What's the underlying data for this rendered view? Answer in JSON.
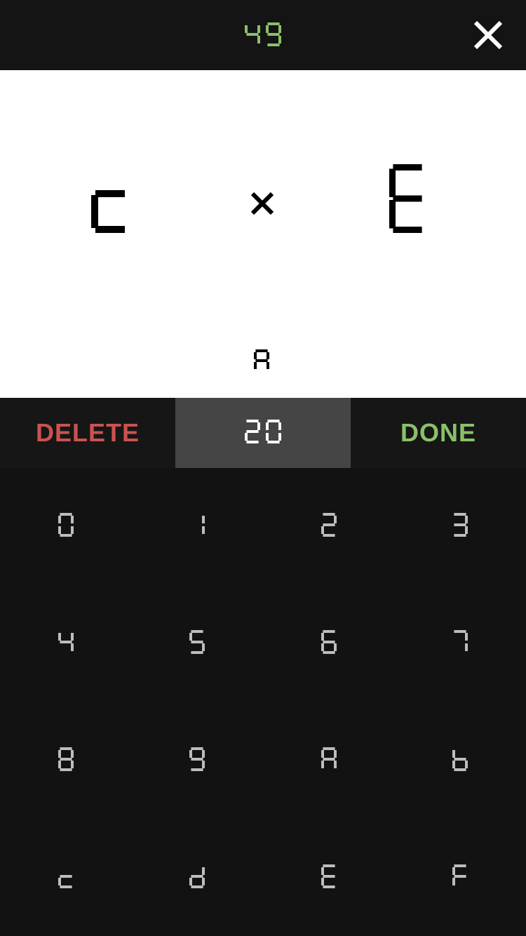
{
  "header": {
    "timer": "49",
    "close_icon": "close-icon"
  },
  "problem": {
    "operand_left": "c",
    "operator": "×",
    "operand_right": "E",
    "hint": "A"
  },
  "actions": {
    "delete_label": "DELETE",
    "answer_value": "20",
    "done_label": "DONE"
  },
  "keypad": {
    "keys": [
      "0",
      "1",
      "2",
      "3",
      "4",
      "5",
      "6",
      "7",
      "8",
      "9",
      "A",
      "b",
      "c",
      "d",
      "E",
      "F"
    ]
  },
  "colors": {
    "timer": "#8bc06a",
    "delete": "#c9534f",
    "done": "#8bc06a",
    "key_digit": "#bdbdbd",
    "problem_text": "#000000"
  }
}
